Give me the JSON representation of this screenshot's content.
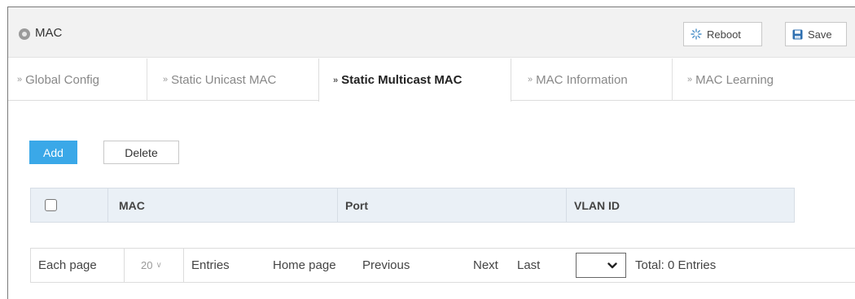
{
  "header": {
    "title": "MAC",
    "icon": "location-pin-icon",
    "reboot_label": "Reboot",
    "save_label": "Save"
  },
  "tabs": [
    {
      "label": "Global Config",
      "active": false
    },
    {
      "label": "Static Unicast MAC",
      "active": false
    },
    {
      "label": "Static Multicast MAC",
      "active": true
    },
    {
      "label": "MAC Information",
      "active": false
    },
    {
      "label": "MAC Learning",
      "active": false
    }
  ],
  "tab_chevron": "»",
  "actions": {
    "add_label": "Add",
    "delete_label": "Delete"
  },
  "table": {
    "columns": [
      "MAC",
      "Port",
      "VLAN ID"
    ],
    "rows": []
  },
  "pagination": {
    "each_page_label": "Each page",
    "page_size": "20",
    "entries_label": "Entries",
    "home_label": "Home page",
    "previous_label": "Previous",
    "next_label": "Next",
    "last_label": "Last",
    "page_select_value": "",
    "total_label": "Total: 0 Entries"
  },
  "colors": {
    "accent": "#3aa8e8",
    "header_bg": "#f2f2f2",
    "table_header_bg": "#eaf0f6"
  }
}
